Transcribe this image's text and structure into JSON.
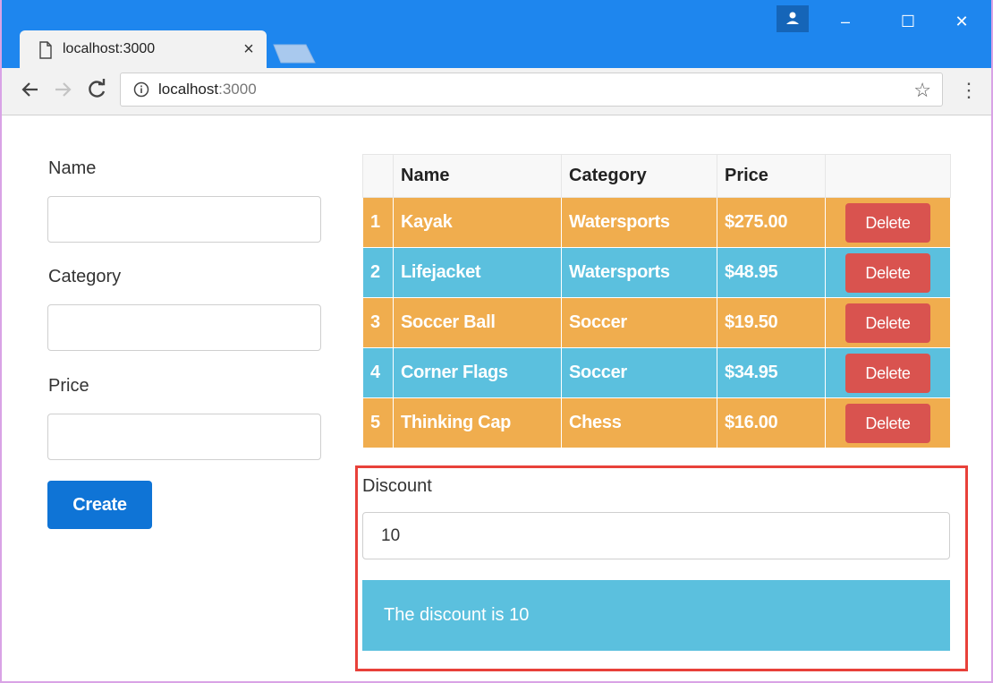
{
  "browser": {
    "tab_title": "localhost:3000",
    "tab_close": "×",
    "url_host": "localhost",
    "url_port": ":3000",
    "window_controls": {
      "minimize": "–",
      "maximize": "☐",
      "close": "✕"
    },
    "icons": {
      "back": "arrow-left-icon",
      "forward": "arrow-right-icon",
      "reload": "reload-icon",
      "info": "info-icon",
      "bookmark": "star-icon",
      "menu": "kebab-menu-icon",
      "profile": "person-icon",
      "page": "page-icon"
    },
    "colors": {
      "titlebar": "#1e86ee",
      "toolbar": "#f2f2f2"
    }
  },
  "form": {
    "name_label": "Name",
    "name_value": "",
    "category_label": "Category",
    "category_value": "",
    "price_label": "Price",
    "price_value": "",
    "create_label": "Create"
  },
  "table": {
    "headers": [
      "",
      "Name",
      "Category",
      "Price",
      ""
    ],
    "rows": [
      {
        "index": "1",
        "name": "Kayak",
        "category": "Watersports",
        "price": "$275.00",
        "action": "Delete",
        "style": "warning"
      },
      {
        "index": "2",
        "name": "Lifejacket",
        "category": "Watersports",
        "price": "$48.95",
        "action": "Delete",
        "style": "info"
      },
      {
        "index": "3",
        "name": "Soccer Ball",
        "category": "Soccer",
        "price": "$19.50",
        "action": "Delete",
        "style": "warning"
      },
      {
        "index": "4",
        "name": "Corner Flags",
        "category": "Soccer",
        "price": "$34.95",
        "action": "Delete",
        "style": "info"
      },
      {
        "index": "5",
        "name": "Thinking Cap",
        "category": "Chess",
        "price": "$16.00",
        "action": "Delete",
        "style": "warning"
      }
    ],
    "colors": {
      "warning": "#f0ad4e",
      "info": "#5bc0de",
      "delete": "#d9534f"
    }
  },
  "discount": {
    "label": "Discount",
    "value": "10",
    "message": "The discount is 10",
    "colors": {
      "highlight_border": "#e8413a",
      "alert": "#5bc0de"
    }
  }
}
